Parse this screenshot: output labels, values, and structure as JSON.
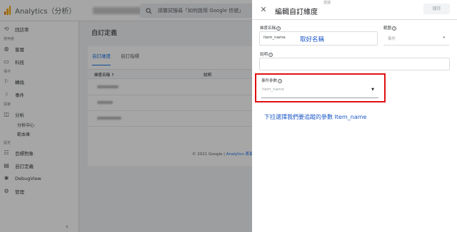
{
  "topbar": {
    "app_title": "Analytics（分析）",
    "search_placeholder": "請嘗試搜尋「如何啟用 Google 信號」"
  },
  "sidenav": {
    "items": [
      {
        "label": "回訪率",
        "icon": "retention-icon"
      },
      {
        "section": "使用者"
      },
      {
        "label": "客層",
        "icon": "globe-icon"
      },
      {
        "label": "科技",
        "icon": "devices-icon"
      },
      {
        "section": "事件"
      },
      {
        "label": "轉換",
        "icon": "flag-icon"
      },
      {
        "label": "事件",
        "icon": "touch-icon"
      },
      {
        "section": "探索"
      },
      {
        "label": "分析",
        "icon": "analysis-icon"
      },
      {
        "sub": "分析中心"
      },
      {
        "sub": "範本庫"
      },
      {
        "section": "設定"
      },
      {
        "label": "目標對象",
        "icon": "audience-icon"
      },
      {
        "label": "自訂定義",
        "icon": "custom-definitions-icon"
      },
      {
        "label": "DebugView",
        "icon": "debug-icon"
      },
      {
        "label": "管理",
        "icon": "gear-icon"
      }
    ]
  },
  "main": {
    "page_title": "自訂定義",
    "tabs": [
      "自訂維度",
      "自訂指標"
    ],
    "columns": {
      "name": "維度名稱 ↑",
      "description": "說明"
    },
    "footer_prefix": "© 2021 Google | ",
    "footer_link": "Analytics 首頁"
  },
  "panel": {
    "top_label": "建議",
    "title": "編輯自訂維度",
    "save_label": "儲存",
    "dimension_name_label": "維度名稱",
    "dimension_name_value": "item_name",
    "scope_label": "範圍",
    "scope_value": "事件",
    "description_label": "說明",
    "event_param_label": "事件參數",
    "event_param_value": "item_name"
  },
  "annotations": {
    "name_note": "取好名稱",
    "param_note": "下拉選擇我們要追蹤的參數 Item_name",
    "color": "#1a56c8",
    "highlight_color": "#e01010"
  }
}
